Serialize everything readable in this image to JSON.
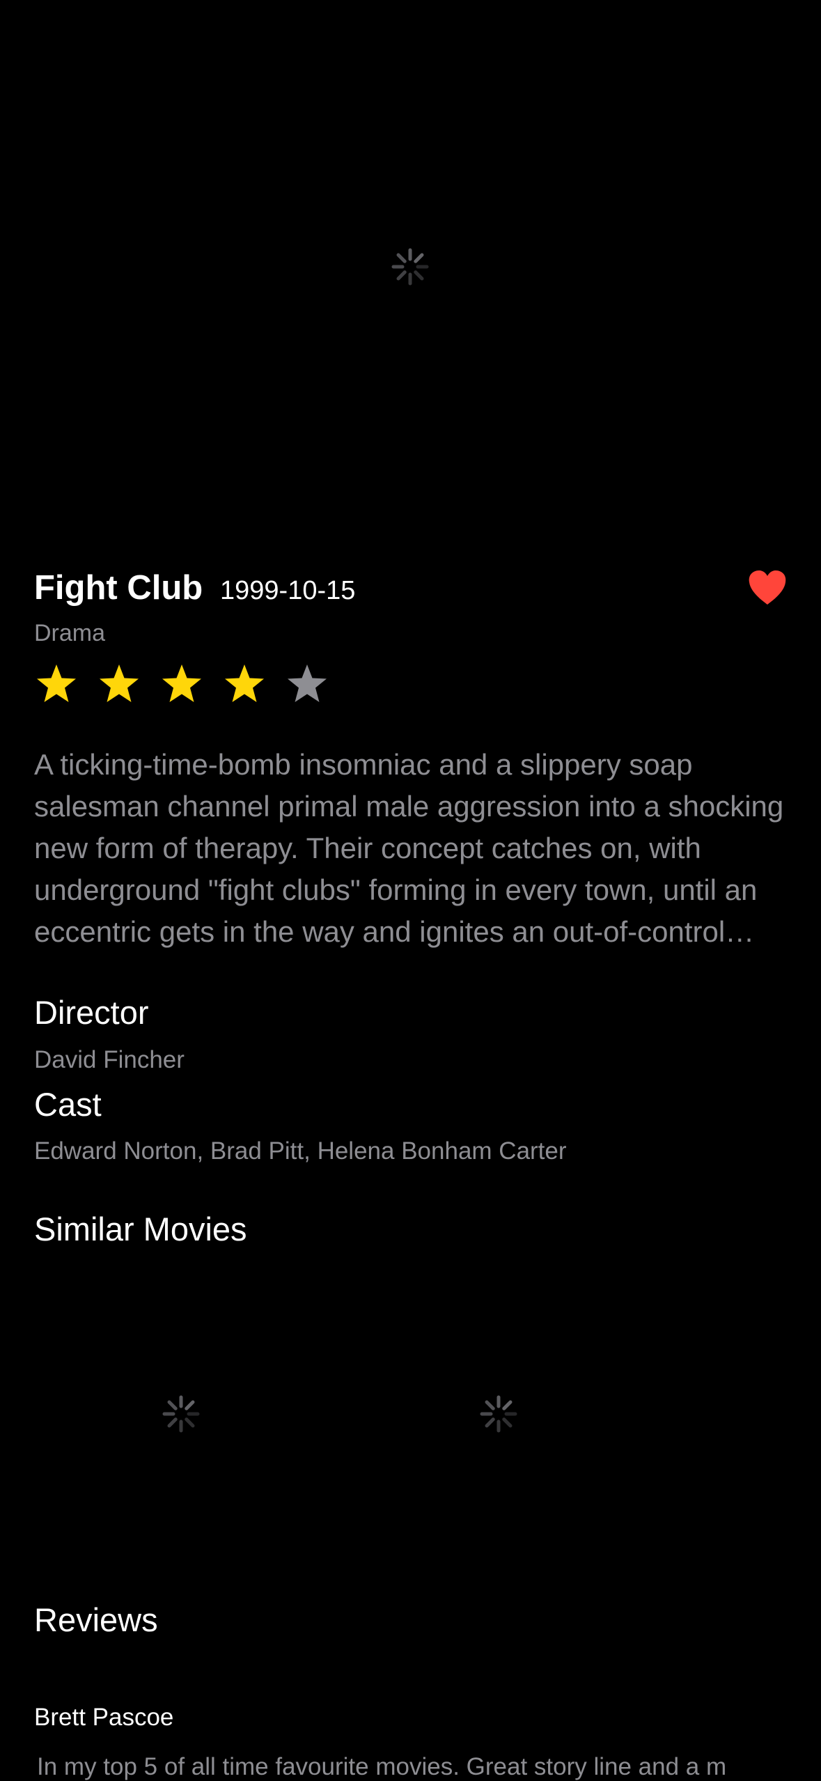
{
  "movie": {
    "title": "Fight Club",
    "release_date": "1999-10-15",
    "genre": "Drama",
    "rating_stars": 4,
    "rating_max": 5,
    "favorited": true,
    "overview": "A ticking-time-bomb insomniac and a slippery soap salesman channel primal male aggression into a shocking new form of therapy. Their concept catches on, with underground \"fight clubs\" forming in every town, until an eccentric gets in the way and ignites an out-of-control spiral toward oblivion."
  },
  "credits": {
    "director_heading": "Director",
    "director": "David Fincher",
    "cast_heading": "Cast",
    "cast": "Edward Norton, Brad Pitt, Helena Bonham Carter"
  },
  "similar": {
    "heading": "Similar Movies",
    "items_loading": 2
  },
  "reviews": {
    "heading": "Reviews",
    "items": [
      {
        "author": "Brett Pascoe",
        "text": "In my top 5 of all time favourite movies. Great story line and a m"
      }
    ]
  },
  "icons": {
    "backdrop_loader": "activity-indicator-icon",
    "favorite": "heart-fill-icon",
    "star": "star-fill-icon",
    "similar_loader": "activity-indicator-icon"
  },
  "colors": {
    "background": "#000000",
    "star_active": "#FFD60A",
    "star_inactive": "#8E8E93",
    "favorite": "#FF453A",
    "secondary_text": "#8E8E93"
  }
}
